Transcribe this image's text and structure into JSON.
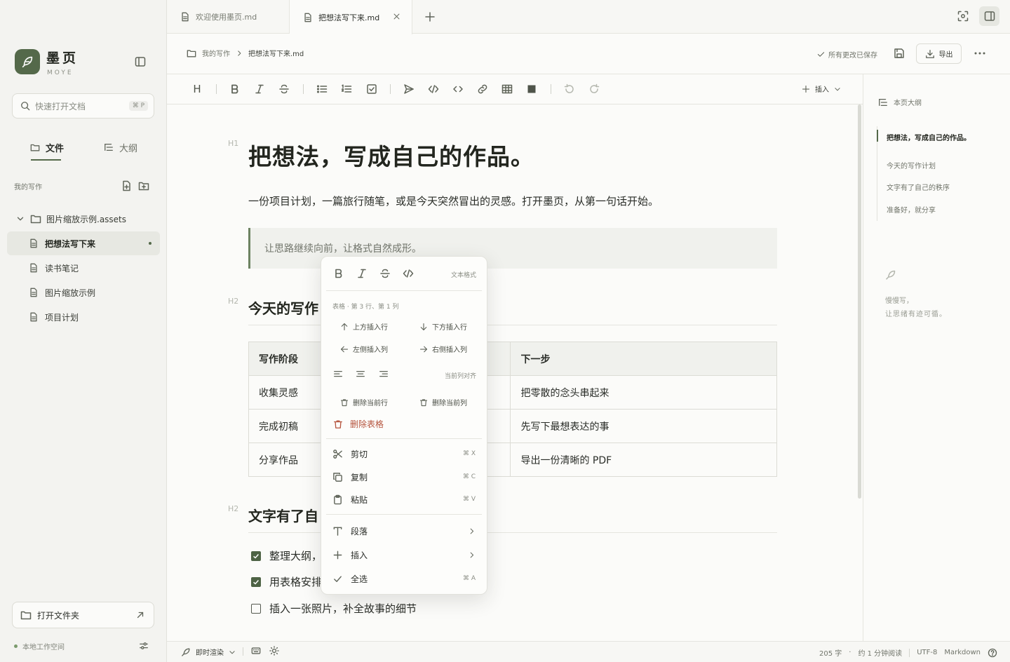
{
  "app": {
    "name": "墨页",
    "name_sub": "MOYE",
    "accent_color": "#54694a"
  },
  "sidebar": {
    "search_placeholder": "快速打开文档",
    "search_shortcut": "⌘ P",
    "tabs": [
      {
        "label": "文件",
        "icon": "folder-icon",
        "active": true
      },
      {
        "label": "大纲",
        "icon": "outline-icon",
        "active": false
      }
    ],
    "section_title": "我的写作",
    "folder": {
      "label": "图片缩放示例.assets",
      "expanded": true
    },
    "files": [
      {
        "label": "把想法写下来",
        "active": true,
        "modified": true
      },
      {
        "label": "读书笔记"
      },
      {
        "label": "图片缩放示例"
      },
      {
        "label": "项目计划"
      }
    ],
    "open_folder_label": "打开文件夹",
    "workspace_label": "本地工作空间"
  },
  "tabs": [
    {
      "label": "欢迎使用墨页.md",
      "active": false
    },
    {
      "label": "把想法写下来.md",
      "active": true
    }
  ],
  "header": {
    "breadcrumb": [
      "我的写作",
      "把想法写下来.md"
    ],
    "saved_status": "所有更改已保存",
    "export_label": "导出"
  },
  "toolbar": {
    "heading_glyph": "H",
    "insert_label": "插入"
  },
  "document": {
    "h1_marker": "H1",
    "h2_marker": "H2",
    "title": "把想法，写成自己的作品。",
    "intro": "一份项目计划，一篇旅行随笔，或是今天突然冒出的灵感。打开墨页，从第一句话开始。",
    "quote": "让思路继续向前，让格式自然成形。",
    "h2_plan": "今天的写作",
    "table": {
      "headers": [
        "写作阶段",
        "",
        "下一步"
      ],
      "rows": [
        [
          "收集灵感",
          "",
          "把零散的念头串起来"
        ],
        [
          "完成初稿",
          "",
          "先写下最想表达的事"
        ],
        [
          "分享作品",
          "",
          "导出一份清晰的 PDF"
        ]
      ]
    },
    "h2_order": "文字有了自",
    "tasks": [
      {
        "label": "整理大纲，",
        "checked": true
      },
      {
        "label": "用表格安排",
        "checked": true
      },
      {
        "label": "插入一张照片，补全故事的细节",
        "checked": false
      }
    ]
  },
  "outline": {
    "title": "本页大纲",
    "items": [
      "把想法，写成自己的作品。",
      "今天的写作计划",
      "文字有了自己的秩序",
      "准备好，就分享"
    ],
    "motto_1": "慢慢写，",
    "motto_2": "让思绪有迹可循。"
  },
  "status": {
    "render_mode": "即时渲染",
    "word_count": "205 字",
    "reading_time": "约 1 分钟阅读",
    "encoding": "UTF-8",
    "format": "Markdown"
  },
  "context_menu": {
    "format_label": "文本格式",
    "table_info": "表格 · 第 3 行、第 1 列",
    "insert_row_above": "上方插入行",
    "insert_row_below": "下方插入行",
    "insert_col_left": "左侧插入列",
    "insert_col_right": "右侧插入列",
    "align_label": "当前列对齐",
    "delete_row": "删除当前行",
    "delete_col": "删除当前列",
    "delete_table": "删除表格",
    "cut": "剪切",
    "cut_shortcut": "⌘ X",
    "copy": "复制",
    "copy_shortcut": "⌘ C",
    "paste": "粘贴",
    "paste_shortcut": "⌘ V",
    "paragraph": "段落",
    "insert": "插入",
    "select_all": "全选",
    "select_all_shortcut": "⌘ A",
    "danger_color": "#b5533c"
  }
}
